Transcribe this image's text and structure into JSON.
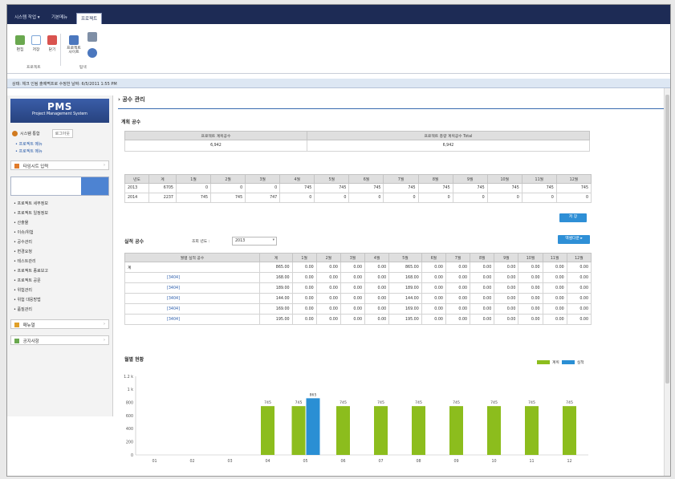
{
  "window": {
    "tabs": [
      {
        "label": "시스템 작업 ▾"
      },
      {
        "label": "기본메뉴"
      },
      {
        "label": "프로젝트"
      }
    ]
  },
  "ribbon": {
    "buttons": [
      {
        "label": "편집",
        "icon": "edit-icon",
        "color": "#6aa84f"
      },
      {
        "label": "저장",
        "icon": "save-icon",
        "color": "#7fa7d9"
      },
      {
        "label": "닫기",
        "icon": "close-icon",
        "color": "#d9534f"
      },
      {
        "label": "프로젝트 사이트",
        "icon": "sitemap-icon",
        "color": "#4b77be"
      },
      {
        "label": "",
        "icon": "server-icon",
        "color": "#7f8fa6"
      },
      {
        "label": "",
        "icon": "people-icon",
        "color": "#4b77be"
      }
    ],
    "groups": [
      "프로젝트",
      "탐색"
    ]
  },
  "status": "상태: 체크 인됨 출예쩍프로 수정한 날짜: 6/5/2011 1:55 PM",
  "sidebar": {
    "brand_title": "PMS",
    "brand_sub": "Project Management System",
    "user": "시스템 통합",
    "logout": "로그아웃",
    "links": [
      "• 프로젝트 메뉴",
      "• 프로젝트 메뉴"
    ],
    "nav_top": {
      "label": "타임시트 입력",
      "icon": "calendar-icon"
    },
    "menu_items": [
      "• 프로젝트 세부정보",
      "• 프로젝트 일정정보",
      "• 산출물",
      "• 이슈/위험",
      "• 공수관리",
      "• 변경요청",
      "• 테스트관리",
      "• 프로젝트 종료보고",
      "• 프로젝트 공문",
      "• 위험관리",
      "• 위험 대응방법",
      "• 품질관리"
    ],
    "nav_bottom": [
      {
        "label": "매뉴얼",
        "icon": "book-icon"
      },
      {
        "label": "공지사항",
        "icon": "megaphone-icon"
      }
    ]
  },
  "main": {
    "page_title": "› 공수 관리",
    "plan": {
      "title": "계획 공수",
      "headers": [
        "프로젝트 계획공수",
        "프로젝트 총량 계획공수 Total"
      ],
      "values": [
        "6,942",
        "6,942"
      ]
    },
    "monthly": {
      "headers": [
        "년도",
        "계",
        "1월",
        "2월",
        "3월",
        "4월",
        "5월",
        "6월",
        "7월",
        "8월",
        "9월",
        "10월",
        "11월",
        "12월"
      ],
      "rows": [
        [
          "2013",
          "6705",
          "0",
          "0",
          "0",
          "745",
          "745",
          "745",
          "745",
          "745",
          "745",
          "745",
          "745",
          "745"
        ],
        [
          "2014",
          "2237",
          "745",
          "745",
          "747",
          "0",
          "0",
          "0",
          "0",
          "0",
          "0",
          "0",
          "0",
          "0"
        ]
      ],
      "save_button": "저 장"
    },
    "actual": {
      "title": "실적 공수",
      "year_label": "조회 년도 :",
      "year_value": "2013",
      "button": "엑셀다운 ▸",
      "headers": [
        "월별 실적 공수",
        "계",
        "1월",
        "2월",
        "3월",
        "4월",
        "5월",
        "6월",
        "7월",
        "8월",
        "9월",
        "10월",
        "11월",
        "12월"
      ],
      "rows": [
        [
          "",
          "계",
          "865.00",
          "0.00",
          "0.00",
          "0.00",
          "0.00",
          "865.00",
          "0.00",
          "0.00",
          "0.00",
          "0.00",
          "0.00",
          "0.00",
          "0.00"
        ],
        [
          "",
          "",
          "168.00",
          "0.00",
          "0.00",
          "0.00",
          "0.00",
          "168.00",
          "0.00",
          "0.00",
          "0.00",
          "0.00",
          "0.00",
          "0.00",
          "0.00"
        ],
        [
          "",
          "",
          "189.00",
          "0.00",
          "0.00",
          "0.00",
          "0.00",
          "189.00",
          "0.00",
          "0.00",
          "0.00",
          "0.00",
          "0.00",
          "0.00",
          "0.00"
        ],
        [
          "",
          "",
          "144.00",
          "0.00",
          "0.00",
          "0.00",
          "0.00",
          "144.00",
          "0.00",
          "0.00",
          "0.00",
          "0.00",
          "0.00",
          "0.00",
          "0.00"
        ],
        [
          "",
          "",
          "169.00",
          "0.00",
          "0.00",
          "0.00",
          "0.00",
          "169.00",
          "0.00",
          "0.00",
          "0.00",
          "0.00",
          "0.00",
          "0.00",
          "0.00"
        ],
        [
          "",
          "",
          "195.00",
          "0.00",
          "0.00",
          "0.00",
          "0.00",
          "195.00",
          "0.00",
          "0.00",
          "0.00",
          "0.00",
          "0.00",
          "0.00",
          "0.00"
        ]
      ],
      "row_links": [
        "",
        "[3404]",
        "[3404]",
        "[3404]",
        "[3404]",
        "[3404]"
      ]
    },
    "status_title": "월별 현황",
    "legend": [
      "계획",
      "실적"
    ]
  },
  "chart_data": {
    "type": "bar",
    "categories": [
      "01",
      "02",
      "03",
      "04",
      "05",
      "06",
      "07",
      "08",
      "09",
      "10",
      "11",
      "12"
    ],
    "series": [
      {
        "name": "계획",
        "color": "#8cbd1d",
        "values": [
          0,
          0,
          0,
          745,
          745,
          745,
          745,
          745,
          745,
          745,
          745,
          745
        ]
      },
      {
        "name": "실적",
        "color": "#2a8fd4",
        "values": [
          0,
          0,
          0,
          0,
          865,
          0,
          0,
          0,
          0,
          0,
          0,
          0
        ]
      }
    ],
    "data_labels": [
      "",
      "",
      "",
      "745",
      "745",
      "745",
      "745",
      "745",
      "745",
      "745",
      "745",
      "745"
    ],
    "actual_labels": [
      "",
      "",
      "",
      "",
      "865",
      "",
      "",
      "",
      "",
      "",
      "",
      ""
    ],
    "ylim": [
      0,
      1200
    ],
    "yticks": [
      "0",
      "200",
      "400",
      "600",
      "800",
      "1 k",
      "1.2 k"
    ],
    "ytick_values": [
      0,
      200,
      400,
      600,
      800,
      1000,
      1200
    ],
    "grid": false,
    "legend_position": "top-right"
  }
}
